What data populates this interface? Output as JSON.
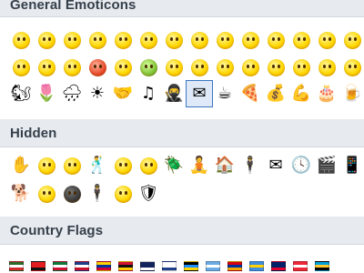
{
  "sections": {
    "general": {
      "title": "General Emoticons"
    },
    "hidden": {
      "title": "Hidden"
    },
    "flags": {
      "title": "Country Flags"
    }
  },
  "colors": {
    "header_bg": "#e7eaee",
    "header_text": "#36404b",
    "selection_border": "#3a77c2"
  },
  "general_rows": [
    [
      "smile-face",
      "sad-face",
      "big-smile-face",
      "cool-face",
      "surprised-face",
      "wink-face",
      "crying-face",
      "sweating-face",
      "speechless-face",
      "kiss-face",
      "tongue-out-face",
      "blush-face",
      "wondering-face",
      "sleepy-face",
      "dull-face"
    ],
    [
      "inlove-face",
      "evil-grin-face",
      "yawn-face",
      "devil-face",
      "angel-face",
      "envy-face",
      "wait-face",
      "bear-face",
      "hug-face",
      "makeup-face",
      "giggle-face",
      "clapping-face",
      "thinking-face",
      "nerd-face",
      "headbang-face"
    ],
    [
      "squirrel",
      "flower",
      "rain",
      "sun",
      "handshake",
      "music",
      "ninja",
      "mail-selected",
      "coffee",
      "pizza",
      "cash",
      "muscle",
      "cake",
      "beer",
      "drink"
    ]
  ],
  "general_glyphs": [
    [
      "",
      "",
      "",
      "",
      "",
      "",
      "",
      "",
      "",
      "",
      "",
      "",
      "",
      "",
      ""
    ],
    [
      "",
      "",
      "",
      "",
      "",
      "",
      "",
      "",
      "",
      "",
      "",
      "",
      "",
      "",
      ""
    ],
    [
      "🐿",
      "🌷",
      "🌧",
      "☀",
      "🤝",
      "♫",
      "🥷",
      "✉",
      "☕",
      "🍕",
      "💰",
      "💪",
      "🎂",
      "🍺",
      "🍸"
    ]
  ],
  "hidden_rows": [
    [
      "finger-hand",
      "bandit-face",
      "nerd-face-2",
      "drunk-man",
      "mooning-face",
      "thinking-face",
      "bug",
      "lie-down",
      "house",
      "man-standing",
      "envelope",
      "clock",
      "movie",
      "phone",
      "laugh-face"
    ],
    [
      "dog",
      "hero-face",
      "dark-hero",
      "soldier",
      "tiger-face",
      "shield-face"
    ]
  ],
  "hidden_glyphs": [
    [
      "✋",
      "",
      "",
      "🕺",
      "",
      "",
      "🪲",
      "🧘",
      "🏠",
      "🕴",
      "✉",
      "🕓",
      "🎬",
      "📱",
      ""
    ],
    [
      "🐕",
      "",
      "",
      "🕴",
      "",
      "🛡"
    ]
  ],
  "flags": [
    {
      "name": "flag-1",
      "colors": [
        "#2c6b2a",
        "#ffffff",
        "#d42a2a"
      ]
    },
    {
      "name": "flag-2",
      "colors": [
        "#e41e20",
        "#e41e20",
        "#111111"
      ]
    },
    {
      "name": "flag-3",
      "colors": [
        "#0b7a3a",
        "#ffffff",
        "#d21034"
      ]
    },
    {
      "name": "flag-4",
      "colors": [
        "#1f3f8a",
        "#ffffff",
        "#c8102e"
      ]
    },
    {
      "name": "flag-5",
      "colors": [
        "#ffd200",
        "#0033a0",
        "#d50032"
      ]
    },
    {
      "name": "flag-6",
      "colors": [
        "#d21034",
        "#111111",
        "#ffcc00"
      ]
    },
    {
      "name": "flag-7",
      "colors": [
        "#13235b",
        "#13235b",
        "#ffffff"
      ]
    },
    {
      "name": "flag-8",
      "colors": [
        "#ffffff",
        "#ffffff",
        "#1f3f8a"
      ]
    },
    {
      "name": "flag-9",
      "colors": [
        "#000000",
        "#1e90ff",
        "#ffd700"
      ]
    },
    {
      "name": "flag-10",
      "colors": [
        "#6cace4",
        "#ffffff",
        "#6cace4"
      ]
    },
    {
      "name": "flag-11",
      "colors": [
        "#d90012",
        "#0033a0",
        "#f2a800"
      ]
    },
    {
      "name": "flag-12",
      "colors": [
        "#418fde",
        "#ffd100",
        "#418fde"
      ]
    },
    {
      "name": "flag-13",
      "colors": [
        "#012169",
        "#012169",
        "#e4002b"
      ]
    },
    {
      "name": "flag-14",
      "colors": [
        "#ed2939",
        "#ffffff",
        "#ed2939"
      ]
    },
    {
      "name": "flag-15",
      "colors": [
        "#00a3dd",
        "#ffc72c",
        "#000000"
      ]
    }
  ]
}
